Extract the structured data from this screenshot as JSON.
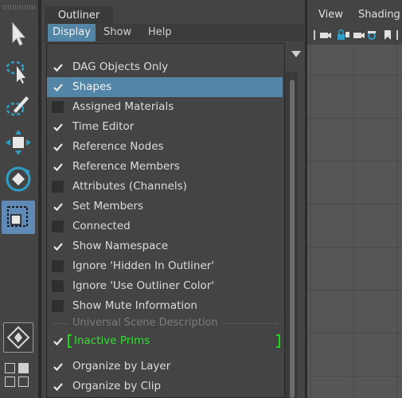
{
  "outliner": {
    "tab_title": "Outliner",
    "menu": [
      "Display",
      "Show",
      "Help"
    ]
  },
  "display_menu": {
    "items": [
      {
        "label": "DAG Objects Only",
        "checked": true
      },
      {
        "label": "Shapes",
        "checked": true,
        "highlighted": true
      },
      {
        "label": "Assigned Materials",
        "checked": false
      },
      {
        "label": "Time Editor",
        "checked": true
      },
      {
        "label": "Reference Nodes",
        "checked": true
      },
      {
        "label": "Reference Members",
        "checked": true
      },
      {
        "label": "Attributes (Channels)",
        "checked": false
      },
      {
        "label": "Set Members",
        "checked": true
      },
      {
        "label": "Connected",
        "checked": false
      },
      {
        "label": "Show Namespace",
        "checked": true
      },
      {
        "label": "Ignore 'Hidden In Outliner'",
        "checked": false
      },
      {
        "label": "Ignore 'Use Outliner Color'",
        "checked": false
      },
      {
        "label": "Show Mute Information",
        "checked": false
      }
    ],
    "section_header": "Universal Scene Description",
    "usd_item": {
      "label": "Inactive Prims",
      "checked": true
    },
    "bottom_items": [
      {
        "label": "Organize by Layer",
        "checked": true
      },
      {
        "label": "Organize by Clip",
        "checked": true
      }
    ]
  },
  "viewport": {
    "menu": [
      "View",
      "Shading"
    ]
  },
  "colors": {
    "highlight": "#5285a6",
    "usd_green": "#2fe22f",
    "active_tool": "#5f8ab5"
  },
  "icons": [
    "select-arrow-icon",
    "lasso-select-icon",
    "paint-select-icon",
    "move-tool-icon",
    "rotate-tool-icon",
    "scale-tool-icon",
    "layout-icon"
  ]
}
